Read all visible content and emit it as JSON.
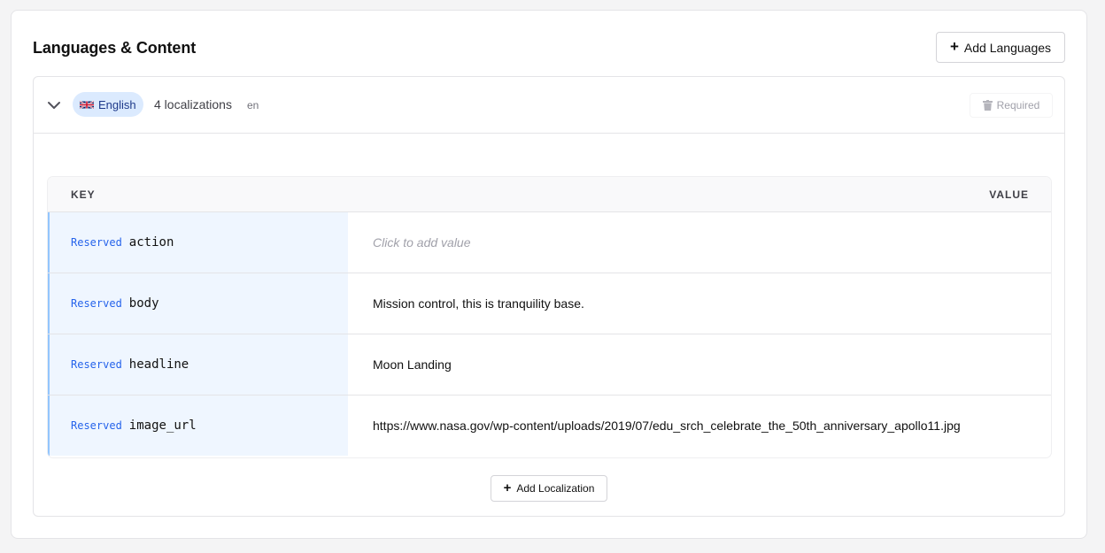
{
  "section": {
    "title": "Languages & Content",
    "add_languages_label": "Add Languages"
  },
  "language": {
    "name": "English",
    "flag_icon": "uk-flag-icon",
    "localization_count": "4 localizations",
    "code": "en",
    "required_label": "Required"
  },
  "table": {
    "key_header": "KEY",
    "value_header": "VALUE",
    "rows": [
      {
        "badge": "Reserved",
        "key": "action",
        "value": "Click to add value"
      },
      {
        "badge": "Reserved",
        "key": "body",
        "value": "Mission control, this is tranquility base."
      },
      {
        "badge": "Reserved",
        "key": "headline",
        "value": "Moon Landing"
      },
      {
        "badge": "Reserved",
        "key": "image_url",
        "value": "https://www.nasa.gov/wp-content/uploads/2019/07/edu_srch_celebrate_the_50th_anniversary_apollo11.jpg"
      }
    ]
  },
  "add_localization_label": "Add Localization",
  "colors": {
    "accent": "#2563eb",
    "chip_bg": "#dbeafe",
    "key_cell_bg": "#eff6ff",
    "key_border": "#93c5fd"
  }
}
